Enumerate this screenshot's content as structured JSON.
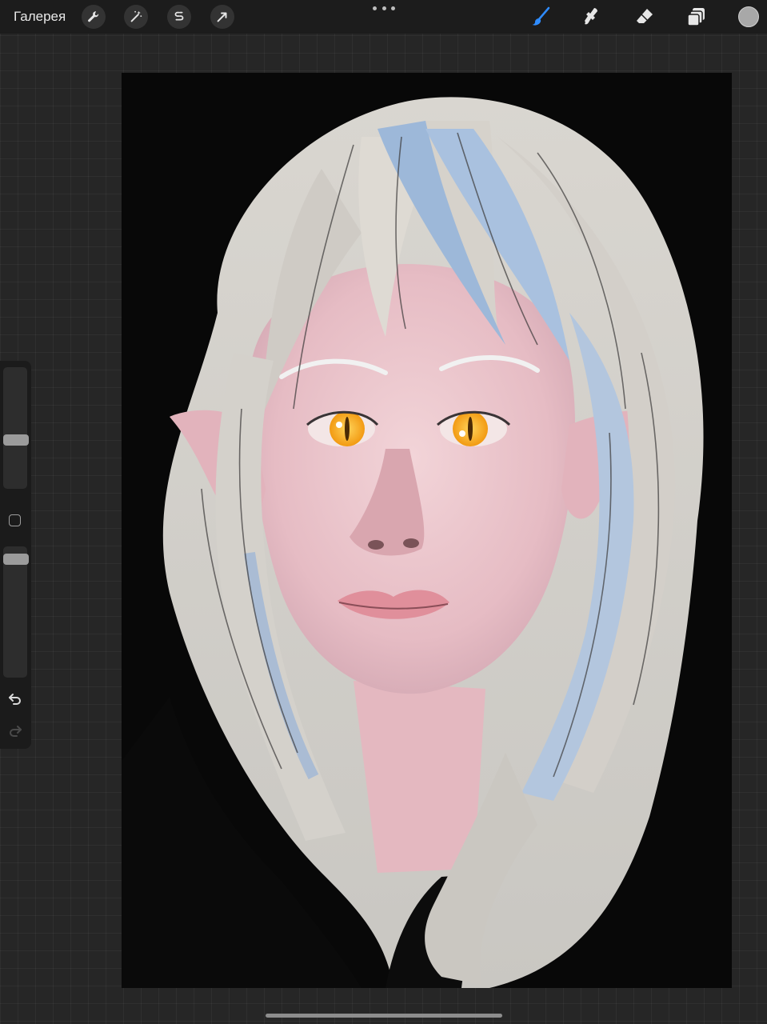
{
  "topbar": {
    "gallery_label": "Галерея",
    "tools_left": [
      "wrench-icon",
      "magic-wand-icon",
      "selection-s-icon",
      "transform-arrow-icon"
    ],
    "tools_right": [
      "brush-icon",
      "smudge-icon",
      "eraser-icon",
      "layers-icon"
    ],
    "accent": "#2f8cff",
    "current_color": "#a8a8a8"
  },
  "sidebar": {
    "brush_size": 0.6,
    "opacity": 0.95
  },
  "canvas": {
    "artwork": "portrait"
  }
}
